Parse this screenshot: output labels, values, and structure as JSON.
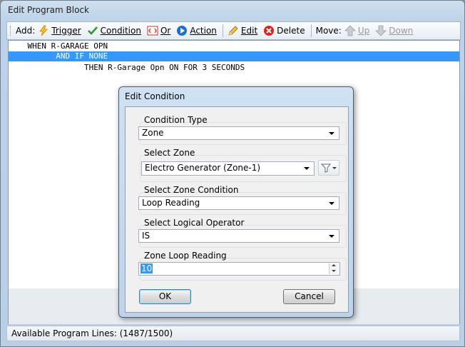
{
  "window": {
    "title": "Edit Program Block"
  },
  "toolbar": {
    "add_label": "Add:",
    "trigger": "Trigger",
    "condition": "Condition",
    "or": "Or",
    "action": "Action",
    "edit": "Edit",
    "delete": "Delete",
    "move_label": "Move:",
    "up": "Up",
    "down": "Down"
  },
  "program": {
    "lines": [
      "    WHEN R-GARAGE OPN",
      "          AND IF NONE",
      "                THEN R-Garage Opn ON FOR 3 SECONDS"
    ],
    "selected_index": 1
  },
  "status": {
    "text": "Available Program Lines: (1487/1500)"
  },
  "dialog": {
    "title": "Edit Condition",
    "condition_type": {
      "label": "Condition Type",
      "value": "Zone"
    },
    "select_zone": {
      "label": "Select Zone",
      "value": "Electro Generator (Zone-1)"
    },
    "zone_condition": {
      "label": "Select Zone Condition",
      "value": "Loop Reading"
    },
    "logical_operator": {
      "label": "Select Logical Operator",
      "value": "IS"
    },
    "loop_reading": {
      "label": "Zone Loop Reading",
      "value": "10"
    },
    "ok": "OK",
    "cancel": "Cancel"
  },
  "colors": {
    "selection": "#3399ff",
    "accent_delete": "#d9261c"
  },
  "icons": [
    "trigger-icon",
    "condition-check-icon",
    "or-icon",
    "action-icon",
    "edit-pencil-icon",
    "delete-icon",
    "up-arrow-icon",
    "down-arrow-icon",
    "filter-icon"
  ]
}
